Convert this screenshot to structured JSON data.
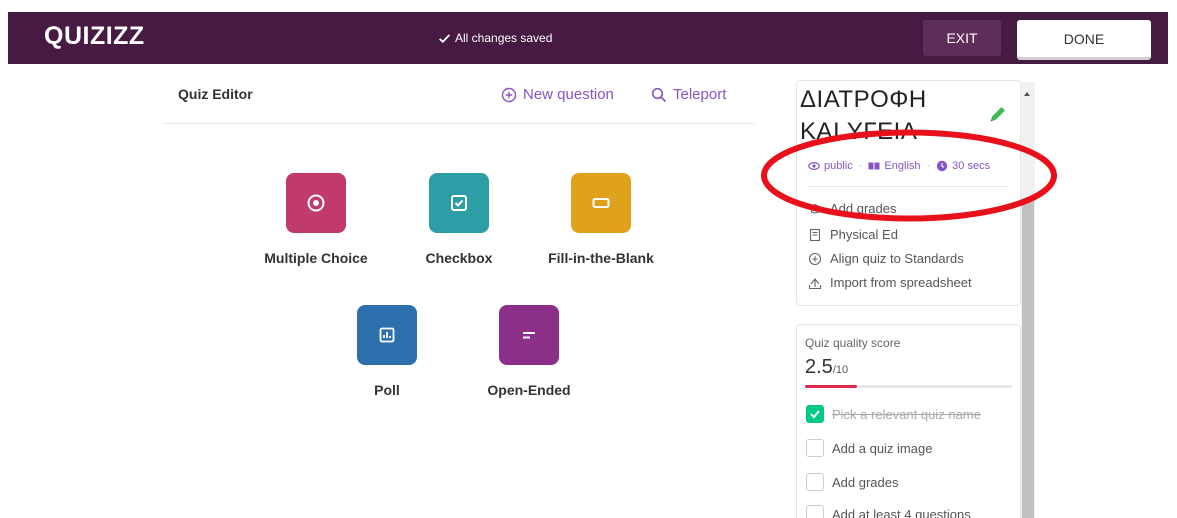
{
  "header": {
    "logo": "QUIZIZZ",
    "save_status": "All changes saved",
    "exit_label": "EXIT",
    "done_label": "DONE",
    "bg_color": "#461a42"
  },
  "editor": {
    "title": "Quiz Editor",
    "new_question": "New question",
    "teleport": "Teleport",
    "accent_color": "#8854c0"
  },
  "question_types": [
    {
      "label": "Multiple Choice",
      "icon": "radio-icon",
      "color": "#c03a6b"
    },
    {
      "label": "Checkbox",
      "icon": "checkbox-icon",
      "color": "#2d9da6"
    },
    {
      "label": "Fill-in-the-Blank",
      "icon": "blank-icon",
      "color": "#e0a11b"
    },
    {
      "label": "Poll",
      "icon": "poll-icon",
      "color": "#2d70ae"
    },
    {
      "label": "Open-Ended",
      "icon": "open-ended-icon",
      "color": "#8c2f88"
    }
  ],
  "quiz": {
    "title": "ΔΙΑΤΡΟΦΗ ΚΑΙ ΥΓΕΙΑ",
    "visibility": "public",
    "language": "English",
    "time": "30 secs",
    "props": [
      "Add grades",
      "Physical Ed",
      "Align quiz to Standards",
      "Import from spreadsheet"
    ]
  },
  "quality": {
    "label": "Quiz quality score",
    "score": "2.5",
    "max": "/10",
    "fill_fraction": 0.25,
    "items": [
      {
        "label": "Pick a relevant quiz name",
        "checked": true
      },
      {
        "label": "Add a quiz image",
        "checked": false
      },
      {
        "label": "Add grades",
        "checked": false
      },
      {
        "label": "Add at least 4 questions",
        "checked": false
      }
    ]
  }
}
